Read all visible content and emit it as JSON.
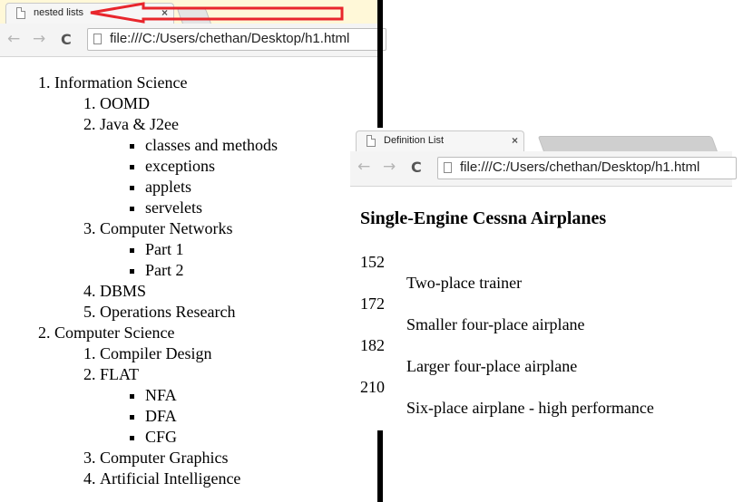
{
  "left_window": {
    "tab_title": "nested lists",
    "tab_close": "×",
    "url": "file:///C:/Users/chethan/Desktop/h1.html",
    "back_icon": "←",
    "forward_icon": "→",
    "reload_icon": "C",
    "list": [
      {
        "label": "Information Science",
        "children": [
          {
            "label": "OOMD",
            "children": []
          },
          {
            "label": "Java & J2ee",
            "children": [
              "classes and methods",
              "exceptions",
              "applets",
              "servelets"
            ]
          },
          {
            "label": "Computer Networks",
            "children": [
              "Part 1",
              "Part 2"
            ]
          },
          {
            "label": "DBMS",
            "children": []
          },
          {
            "label": "Operations Research",
            "children": []
          }
        ]
      },
      {
        "label": "Computer Science",
        "children": [
          {
            "label": "Compiler Design",
            "children": []
          },
          {
            "label": "FLAT",
            "children": [
              "NFA",
              "DFA",
              "CFG"
            ]
          },
          {
            "label": "Computer Graphics",
            "children": []
          },
          {
            "label": "Artificial Intelligence",
            "children": []
          }
        ]
      }
    ]
  },
  "right_window": {
    "tab_title": "Definition List",
    "tab_close": "×",
    "url": "file:///C:/Users/chethan/Desktop/h1.html",
    "heading": "Single-Engine Cessna Airplanes",
    "definitions": [
      {
        "term": "152",
        "desc": "Two-place trainer"
      },
      {
        "term": "172",
        "desc": "Smaller four-place airplane"
      },
      {
        "term": "182",
        "desc": "Larger four-place airplane"
      },
      {
        "term": "210",
        "desc": "Six-place airplane - high performance"
      }
    ]
  },
  "colors": {
    "annotation_arrow": "#e8262c",
    "divider": "#000000"
  }
}
